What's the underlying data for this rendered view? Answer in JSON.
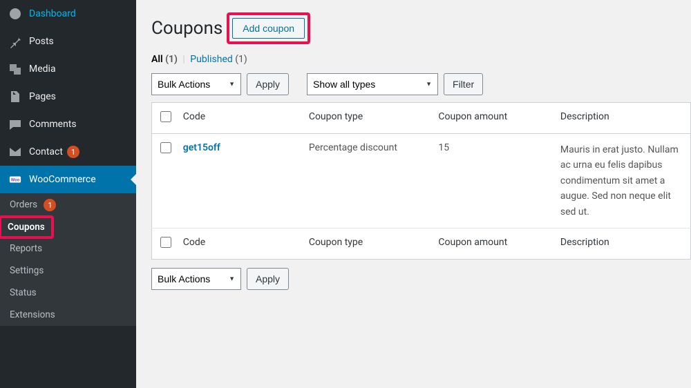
{
  "sidebar": {
    "items": [
      {
        "label": "Dashboard",
        "icon": "dashboard"
      },
      {
        "label": "Posts",
        "icon": "pin"
      },
      {
        "label": "Media",
        "icon": "media"
      },
      {
        "label": "Pages",
        "icon": "pages"
      },
      {
        "label": "Comments",
        "icon": "comments"
      },
      {
        "label": "Contact",
        "icon": "contact",
        "badge": "1"
      },
      {
        "label": "WooCommerce",
        "icon": "woo",
        "current": true
      }
    ]
  },
  "submenu": {
    "items": [
      {
        "label": "Orders",
        "badge": "1"
      },
      {
        "label": "Coupons",
        "active": true
      },
      {
        "label": "Reports"
      },
      {
        "label": "Settings"
      },
      {
        "label": "Status"
      },
      {
        "label": "Extensions"
      }
    ]
  },
  "header": {
    "title": "Coupons",
    "add_button": "Add coupon"
  },
  "filters": {
    "all_label": "All",
    "all_count": "(1)",
    "published_label": "Published",
    "published_count": "(1)"
  },
  "controls": {
    "bulk_action_selected": "Bulk Actions",
    "apply": "Apply",
    "type_filter_selected": "Show all types",
    "filter": "Filter"
  },
  "table": {
    "headers": {
      "code": "Code",
      "type": "Coupon type",
      "amount": "Coupon amount",
      "description": "Description"
    },
    "rows": [
      {
        "code": "get15off",
        "type": "Percentage discount",
        "amount": "15",
        "description": "Mauris in erat justo. Nullam ac urna eu felis dapibus condimentum sit amet a augue. Sed non neque elit sed ut."
      }
    ]
  }
}
